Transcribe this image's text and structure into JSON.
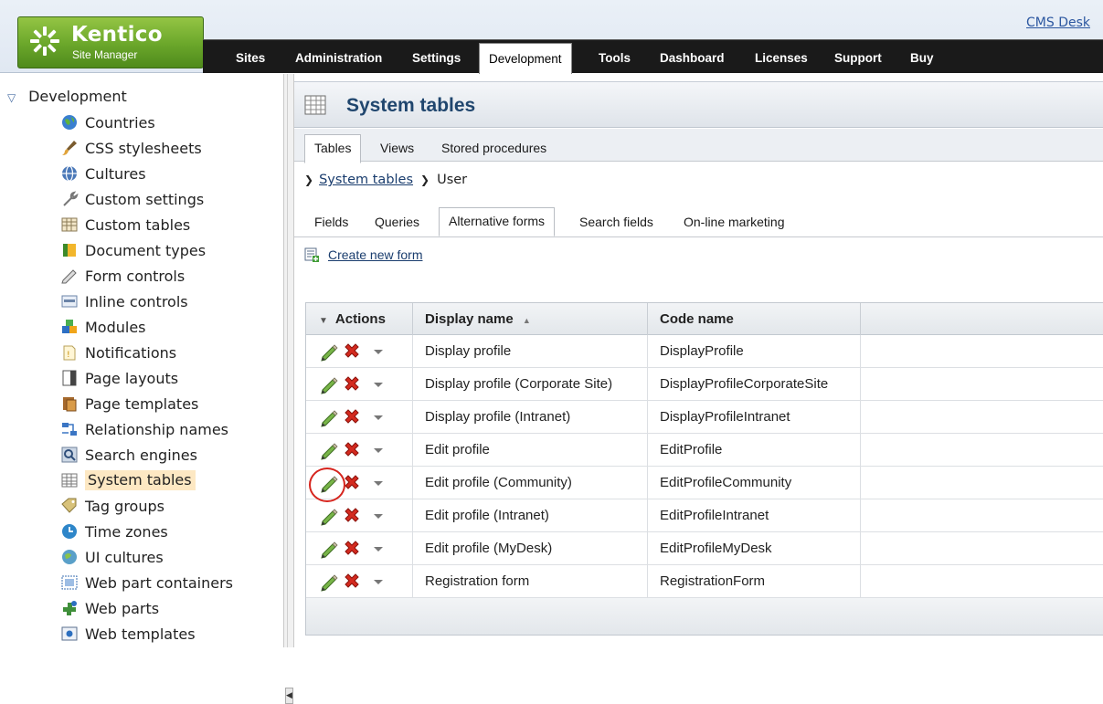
{
  "header": {
    "logo_title": "Kentico",
    "logo_subtitle": "Site Manager",
    "cms_desk_link": "CMS Desk",
    "nav_tabs": [
      {
        "label": "Sites"
      },
      {
        "label": "Administration"
      },
      {
        "label": "Settings"
      },
      {
        "label": "Development",
        "active": true
      },
      {
        "label": "Tools"
      },
      {
        "label": "Dashboard"
      },
      {
        "label": "Licenses"
      },
      {
        "label": "Support"
      },
      {
        "label": "Buy"
      }
    ]
  },
  "sidebar": {
    "root_label": "Development",
    "items": [
      {
        "label": "Countries",
        "icon": "globe-icon"
      },
      {
        "label": "CSS stylesheets",
        "icon": "brush-icon"
      },
      {
        "label": "Cultures",
        "icon": "culture-globe-icon"
      },
      {
        "label": "Custom settings",
        "icon": "wrench-icon"
      },
      {
        "label": "Custom tables",
        "icon": "table-icon"
      },
      {
        "label": "Document types",
        "icon": "document-type-icon"
      },
      {
        "label": "Form controls",
        "icon": "form-controls-icon"
      },
      {
        "label": "Inline controls",
        "icon": "inline-controls-icon"
      },
      {
        "label": "Modules",
        "icon": "modules-icon"
      },
      {
        "label": "Notifications",
        "icon": "notification-icon"
      },
      {
        "label": "Page layouts",
        "icon": "page-layout-icon"
      },
      {
        "label": "Page templates",
        "icon": "page-template-icon"
      },
      {
        "label": "Relationship names",
        "icon": "relationship-icon"
      },
      {
        "label": "Search engines",
        "icon": "search-engine-icon"
      },
      {
        "label": "System tables",
        "icon": "system-table-icon",
        "selected": true
      },
      {
        "label": "Tag groups",
        "icon": "tag-icon"
      },
      {
        "label": "Time zones",
        "icon": "time-zone-icon"
      },
      {
        "label": "UI cultures",
        "icon": "ui-culture-icon"
      },
      {
        "label": "Web part containers",
        "icon": "web-part-container-icon"
      },
      {
        "label": "Web parts",
        "icon": "web-part-icon"
      },
      {
        "label": "Web templates",
        "icon": "web-template-icon"
      }
    ]
  },
  "main": {
    "page_title": "System tables",
    "top_tabs": [
      {
        "label": "Tables",
        "active": true
      },
      {
        "label": "Views"
      },
      {
        "label": "Stored procedures"
      }
    ],
    "breadcrumb": {
      "link": "System tables",
      "current": "User"
    },
    "object_tabs": [
      {
        "label": "Fields"
      },
      {
        "label": "Queries"
      },
      {
        "label": "Alternative forms",
        "active": true
      },
      {
        "label": "Search fields"
      },
      {
        "label": "On-line marketing"
      }
    ],
    "create_new_label": "Create new form",
    "grid": {
      "columns": [
        "Actions",
        "Display name",
        "Code name"
      ],
      "sort_indicator": "▲",
      "rows": [
        {
          "display_name": "Display profile",
          "code_name": "DisplayProfile"
        },
        {
          "display_name": "Display profile (Corporate Site)",
          "code_name": "DisplayProfileCorporateSite"
        },
        {
          "display_name": "Display profile (Intranet)",
          "code_name": "DisplayProfileIntranet"
        },
        {
          "display_name": "Edit profile",
          "code_name": "EditProfile"
        },
        {
          "display_name": "Edit profile (Community)",
          "code_name": "EditProfileCommunity",
          "highlighted_edit": true
        },
        {
          "display_name": "Edit profile (Intranet)",
          "code_name": "EditProfileIntranet"
        },
        {
          "display_name": "Edit profile (MyDesk)",
          "code_name": "EditProfileMyDesk"
        },
        {
          "display_name": "Registration form",
          "code_name": "RegistrationForm"
        }
      ]
    }
  }
}
